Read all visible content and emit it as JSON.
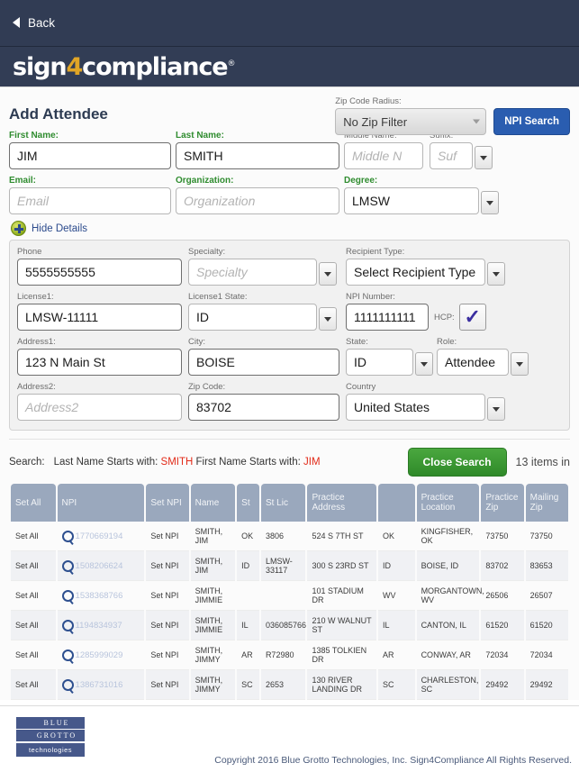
{
  "nav": {
    "back_label": "Back"
  },
  "brand": {
    "text_a": "sign",
    "four": "4",
    "text_b": "compliance",
    "reg": "®"
  },
  "header": {
    "title": "Add Attendee",
    "zip_radius_label": "Zip Code Radius:",
    "zip_radius_value": "No Zip Filter",
    "npi_search_label": "NPI Search"
  },
  "form": {
    "first_name_label": "First Name:",
    "first_name_value": "JIM",
    "last_name_label": "Last Name:",
    "last_name_value": "SMITH",
    "middle_name_label": "Middle Name:",
    "middle_name_placeholder": "Middle N",
    "suffix_label": "Suffix:",
    "suffix_placeholder": "Suf",
    "email_label": "Email:",
    "email_placeholder": "Email",
    "organization_label": "Organization:",
    "organization_placeholder": "Organization",
    "degree_label": "Degree:",
    "degree_value": "LMSW"
  },
  "details": {
    "toggle_label": "Hide Details",
    "phone_label": "Phone",
    "phone_value": "5555555555",
    "specialty_label": "Specialty:",
    "specialty_placeholder": "Specialty",
    "recipient_type_label": "Recipient Type:",
    "recipient_type_value": "Select Recipient Type",
    "license1_label": "License1:",
    "license1_value": "LMSW-11111",
    "license1_state_label": "License1 State:",
    "license1_state_value": "ID",
    "npi_number_label": "NPI Number:",
    "npi_number_value": "1111111111",
    "hcp_label": "HCP:",
    "hcp_checked": "✓",
    "address1_label": "Address1:",
    "address1_value": "123 N Main St",
    "city_label": "City:",
    "city_value": "BOISE",
    "state_label": "State:",
    "state_value": "ID",
    "role_label": "Role:",
    "role_value": "Attendee",
    "address2_label": "Address2:",
    "address2_placeholder": "Address2",
    "zip_code_label": "Zip Code:",
    "zip_code_value": "83702",
    "country_label": "Country",
    "country_value": "United States"
  },
  "search": {
    "label": "Search:",
    "last_name_prefix": "Last Name Starts with:",
    "last_name_value": "SMITH",
    "first_name_prefix": "First Name Starts with:",
    "first_name_value": "JIM",
    "close_button": "Close Search",
    "items_count": "13 items in"
  },
  "table": {
    "columns": [
      "Set All",
      "NPI",
      "Set NPI",
      "Name",
      "St",
      "St Lic",
      "Practice Address",
      "",
      "Practice Location",
      "Practice Zip",
      "Mailing Zip"
    ],
    "rows": [
      {
        "set_all": "Set All",
        "npi": "1770669194",
        "set_npi": "Set NPI",
        "name": "SMITH, JIM",
        "st": "OK",
        "st_lic": "3806",
        "practice_address": "524 S 7TH ST",
        "state2": "OK",
        "practice_location": "KINGFISHER, OK",
        "practice_zip": "73750",
        "mailing_zip": "73750"
      },
      {
        "set_all": "Set All",
        "npi": "1508206624",
        "set_npi": "Set NPI",
        "name": "SMITH, JIM",
        "st": "ID",
        "st_lic": "LMSW-33117",
        "practice_address": "300 S 23RD ST",
        "state2": "ID",
        "practice_location": "BOISE, ID",
        "practice_zip": "83702",
        "mailing_zip": "83653"
      },
      {
        "set_all": "Set All",
        "npi": "1538368766",
        "set_npi": "Set NPI",
        "name": "SMITH, JIMMIE",
        "st": "",
        "st_lic": "",
        "practice_address": "101 STADIUM DR",
        "state2": "WV",
        "practice_location": "MORGANTOWN, WV",
        "practice_zip": "26506",
        "mailing_zip": "26507"
      },
      {
        "set_all": "Set All",
        "npi": "1194834937",
        "set_npi": "Set NPI",
        "name": "SMITH, JIMMIE",
        "st": "IL",
        "st_lic": "036085766",
        "practice_address": "210 W WALNUT ST",
        "state2": "IL",
        "practice_location": "CANTON, IL",
        "practice_zip": "61520",
        "mailing_zip": "61520"
      },
      {
        "set_all": "Set All",
        "npi": "1285999029",
        "set_npi": "Set NPI",
        "name": "SMITH, JIMMY",
        "st": "AR",
        "st_lic": "R72980",
        "practice_address": "1385 TOLKIEN DR",
        "state2": "AR",
        "practice_location": "CONWAY, AR",
        "practice_zip": "72034",
        "mailing_zip": "72034"
      },
      {
        "set_all": "Set All",
        "npi": "1386731016",
        "set_npi": "Set NPI",
        "name": "SMITH, JIMMY",
        "st": "SC",
        "st_lic": "2653",
        "practice_address": "130 RIVER LANDING DR",
        "state2": "SC",
        "practice_location": "CHARLESTON, SC",
        "practice_zip": "29492",
        "mailing_zip": "29492"
      }
    ]
  },
  "footer": {
    "logo_line1": "BLUE",
    "logo_line2": "GROTTO",
    "logo_line3": "technologies",
    "copyright": "Copyright 2016 Blue Grotto Technologies, Inc.  Sign4Compliance All Rights Reserved."
  },
  "colors": {
    "header_navy": "#313c54",
    "accent_gold": "#e0a526",
    "label_green": "#2f8c2f",
    "criteria_red": "#e22a18",
    "button_blue": "#2a5db0",
    "button_green": "#3c9433",
    "table_header": "#9aa8bd",
    "link_blue": "#3c69b3"
  }
}
